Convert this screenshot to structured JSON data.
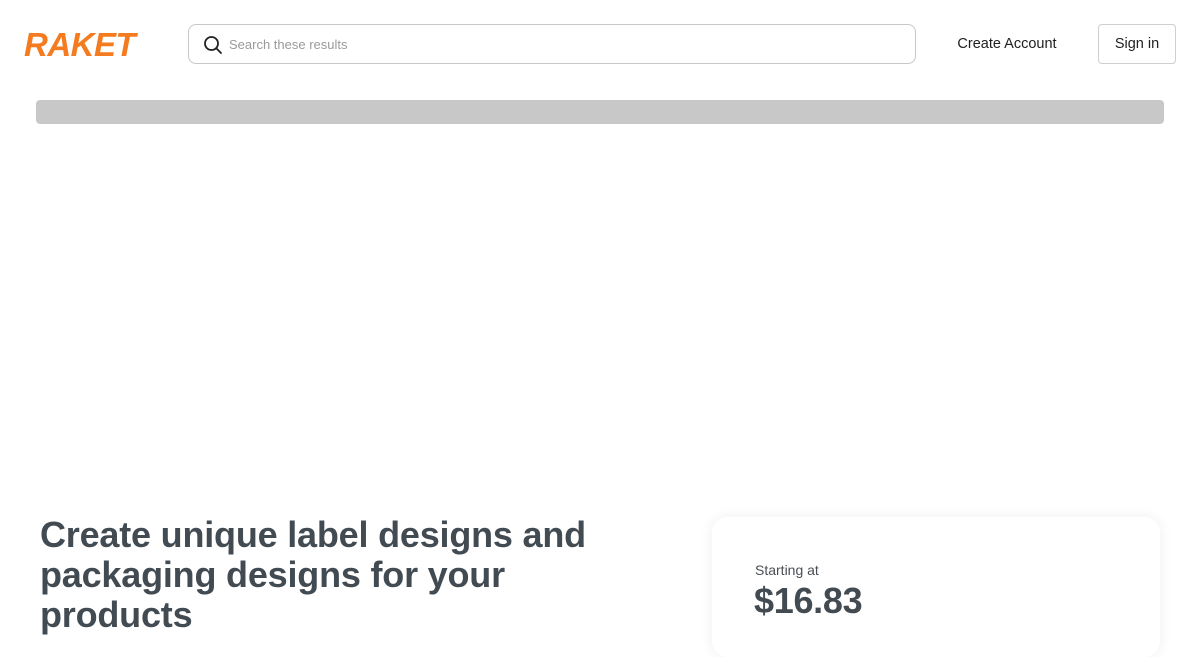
{
  "brand": {
    "name": "RAKET",
    "accent_color": "#f47b20"
  },
  "search": {
    "placeholder": "Search these results",
    "value": ""
  },
  "nav": {
    "create_account_label": "Create Account",
    "sign_in_label": "Sign in"
  },
  "hero": {
    "title": "Create unique label designs and packaging designs for your products"
  },
  "pricing": {
    "label": "Starting at",
    "price": "$16.83"
  },
  "icons": {
    "search": "search-icon",
    "logo": "raket-logo"
  }
}
